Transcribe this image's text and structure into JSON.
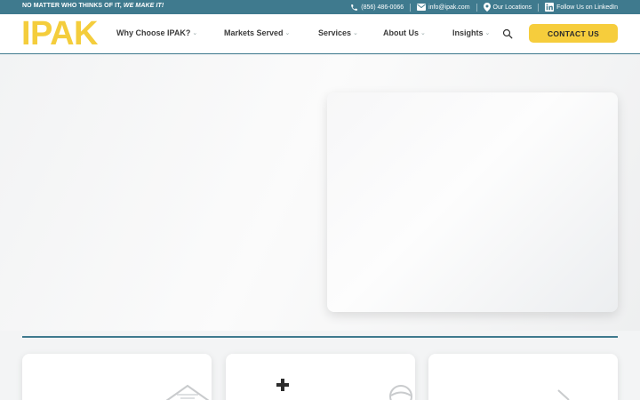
{
  "topbar": {
    "tagline_main": "NO MATTER WHO THINKS OF IT,",
    "tagline_em": "WE MAKE IT!",
    "phone": "(856) 486-0066",
    "email": "info@ipak.com",
    "locations": "Our Locations",
    "linkedin": "Follow Us on LinkedIn"
  },
  "header": {
    "logo": "IPAK",
    "nav": [
      "Why Choose IPAK?",
      "Markets Served",
      "Services",
      "About Us",
      "Insights"
    ],
    "cta": "CONTACT US"
  },
  "colors": {
    "brand_teal": "#3f7a8e",
    "brand_yellow": "#f4cd3c"
  }
}
